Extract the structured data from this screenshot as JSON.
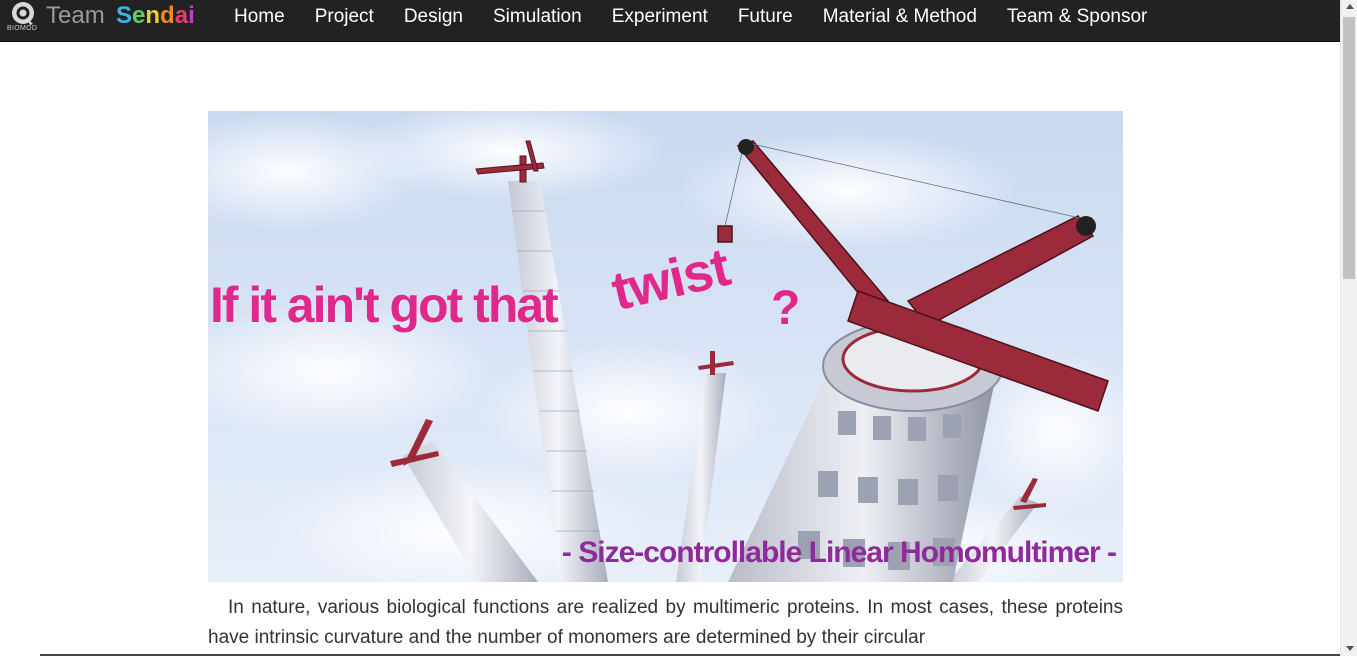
{
  "brand": {
    "badge": "BIOMOD",
    "team": "Team",
    "sendai_letters": [
      "S",
      "e",
      "n",
      "d",
      "a",
      "i"
    ],
    "sendai_colors": [
      "#3fb3e6",
      "#5ecf6a",
      "#e8d230",
      "#ef8a2a",
      "#e23b6c",
      "#c63ad0"
    ]
  },
  "nav": {
    "items": [
      {
        "label": "Home"
      },
      {
        "label": "Project"
      },
      {
        "label": "Design"
      },
      {
        "label": "Simulation"
      },
      {
        "label": "Experiment"
      },
      {
        "label": "Future"
      },
      {
        "label": "Material & Method"
      },
      {
        "label": "Team & Sponsor"
      }
    ]
  },
  "hero": {
    "title": "If it ain't got that",
    "twist": "twist",
    "question": "?",
    "subtitle": "- Size-controllable Linear Homomultimer -"
  },
  "intro": {
    "text": "In nature, various biological functions are realized by multimeric proteins. In most cases, these proteins have intrinsic curvature and the number of monomers are determined by their circular"
  },
  "colors": {
    "navbar_bg": "#222222",
    "title_pink": "#e0288c",
    "subtitle_purple": "#8e2a9a",
    "crane_red": "#9b2a3a"
  }
}
